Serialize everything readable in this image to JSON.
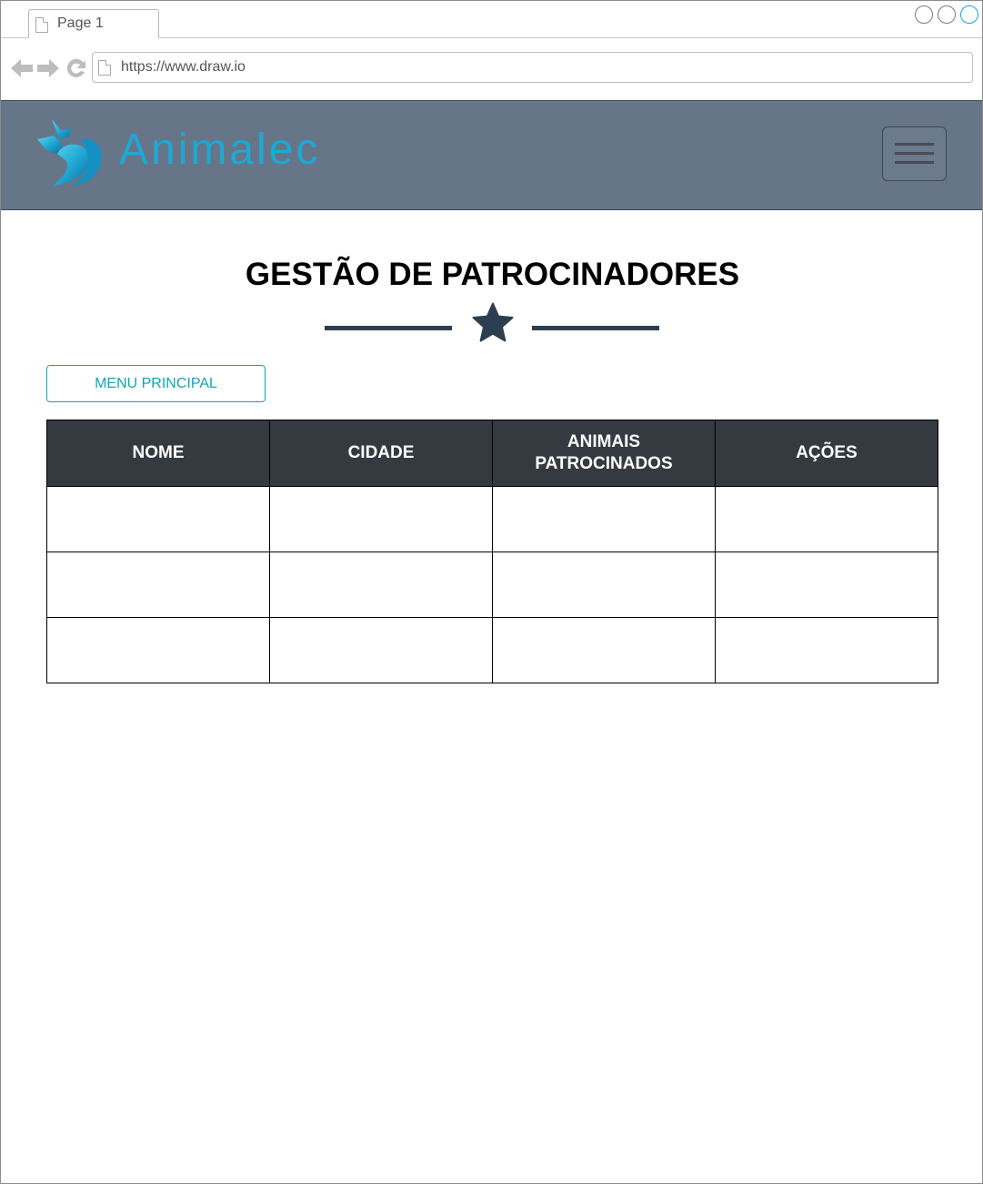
{
  "browser": {
    "tab_label": "Page 1",
    "url": "https://www.draw.io"
  },
  "header": {
    "brand_name": "Animalec",
    "brand_color": "#1ea8d4",
    "background_color": "#667587",
    "menu_icon": "hamburger-menu-icon"
  },
  "page": {
    "title": "GESTÃO DE PATROCINADORES",
    "divider_icon": "star-icon",
    "menu_button_label": "MENU PRINCIPAL",
    "accent_color": "#13a3b5"
  },
  "table": {
    "columns": [
      "NOME",
      "CIDADE",
      "ANIMAIS\nPATROCINADOS",
      "AÇÕES"
    ],
    "rows": [
      [
        "",
        "",
        "",
        ""
      ],
      [
        "",
        "",
        "",
        ""
      ],
      [
        "",
        "",
        "",
        ""
      ]
    ]
  }
}
